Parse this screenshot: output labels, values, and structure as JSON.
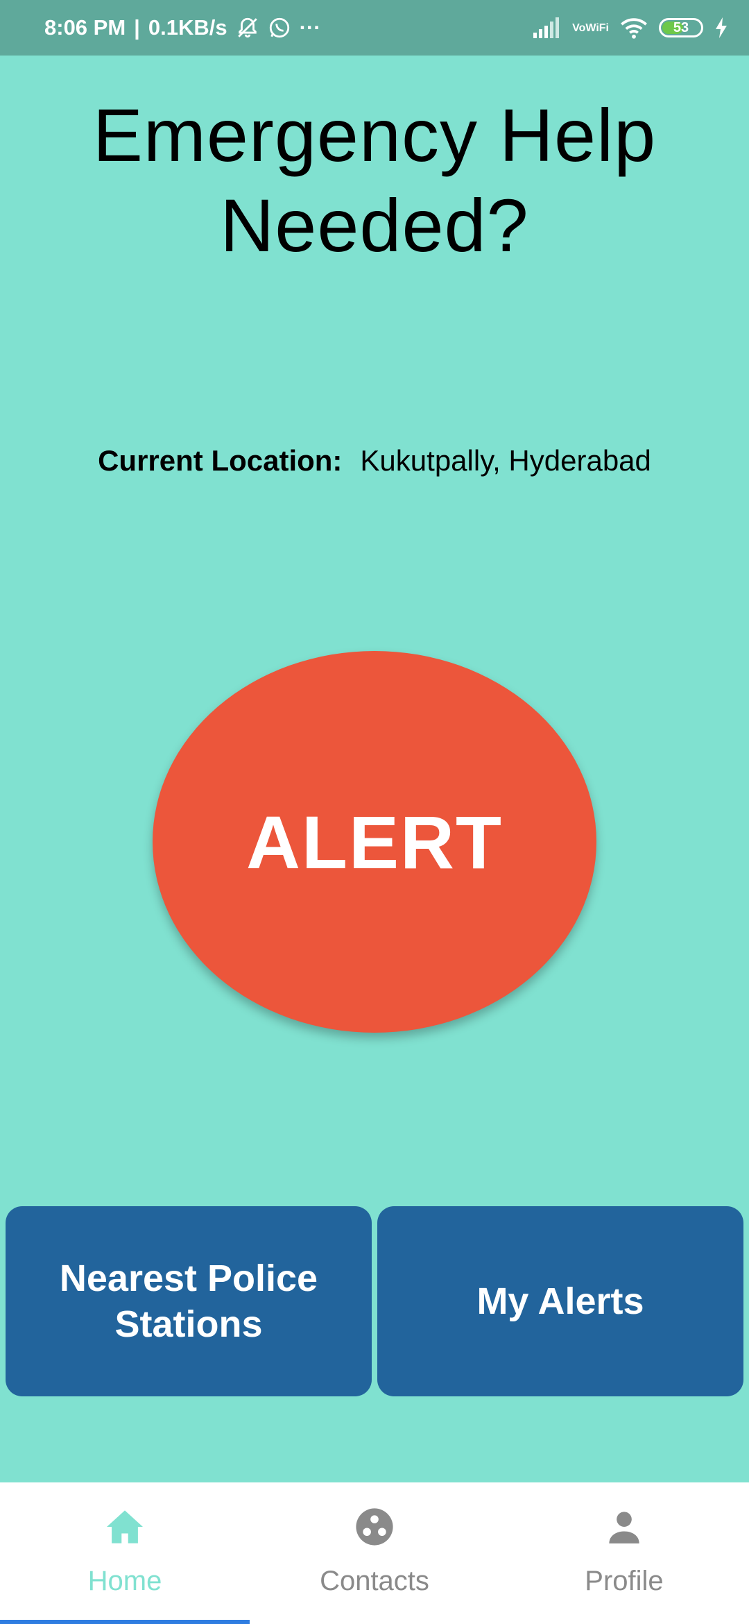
{
  "status_bar": {
    "time": "8:06 PM",
    "separator": "|",
    "net_speed": "0.1KB/s",
    "overflow": "···",
    "volte_top": "Vo",
    "volte_bottom": "WiFi",
    "battery": "53",
    "icons": [
      "bell-off-icon",
      "whatsapp-icon",
      "signal-icon",
      "wifi-icon",
      "battery-icon",
      "charging-bolt-icon"
    ]
  },
  "header": {
    "title_line1": "Emergency Help",
    "title_line2": "Needed?"
  },
  "location": {
    "label": "Current Location:",
    "value": "Kukutpally, Hyderabad"
  },
  "alert_button": {
    "label": "ALERT",
    "color": "#ec563b"
  },
  "actions": {
    "police_line1": "Nearest Police",
    "police_line2": "Stations",
    "alerts": "My Alerts",
    "color": "#22649c"
  },
  "bottom_nav": {
    "items": [
      {
        "label": "Home",
        "icon": "home-icon",
        "active": true
      },
      {
        "label": "Contacts",
        "icon": "contacts-icon",
        "active": false
      },
      {
        "label": "Profile",
        "icon": "person-icon",
        "active": false
      }
    ],
    "active_color": "#80e1d0",
    "inactive_color": "#8a8a8a",
    "indicator_color": "#2f7de1"
  },
  "colors": {
    "background": "#80e1d0",
    "status_bar": "#5fa99b"
  }
}
